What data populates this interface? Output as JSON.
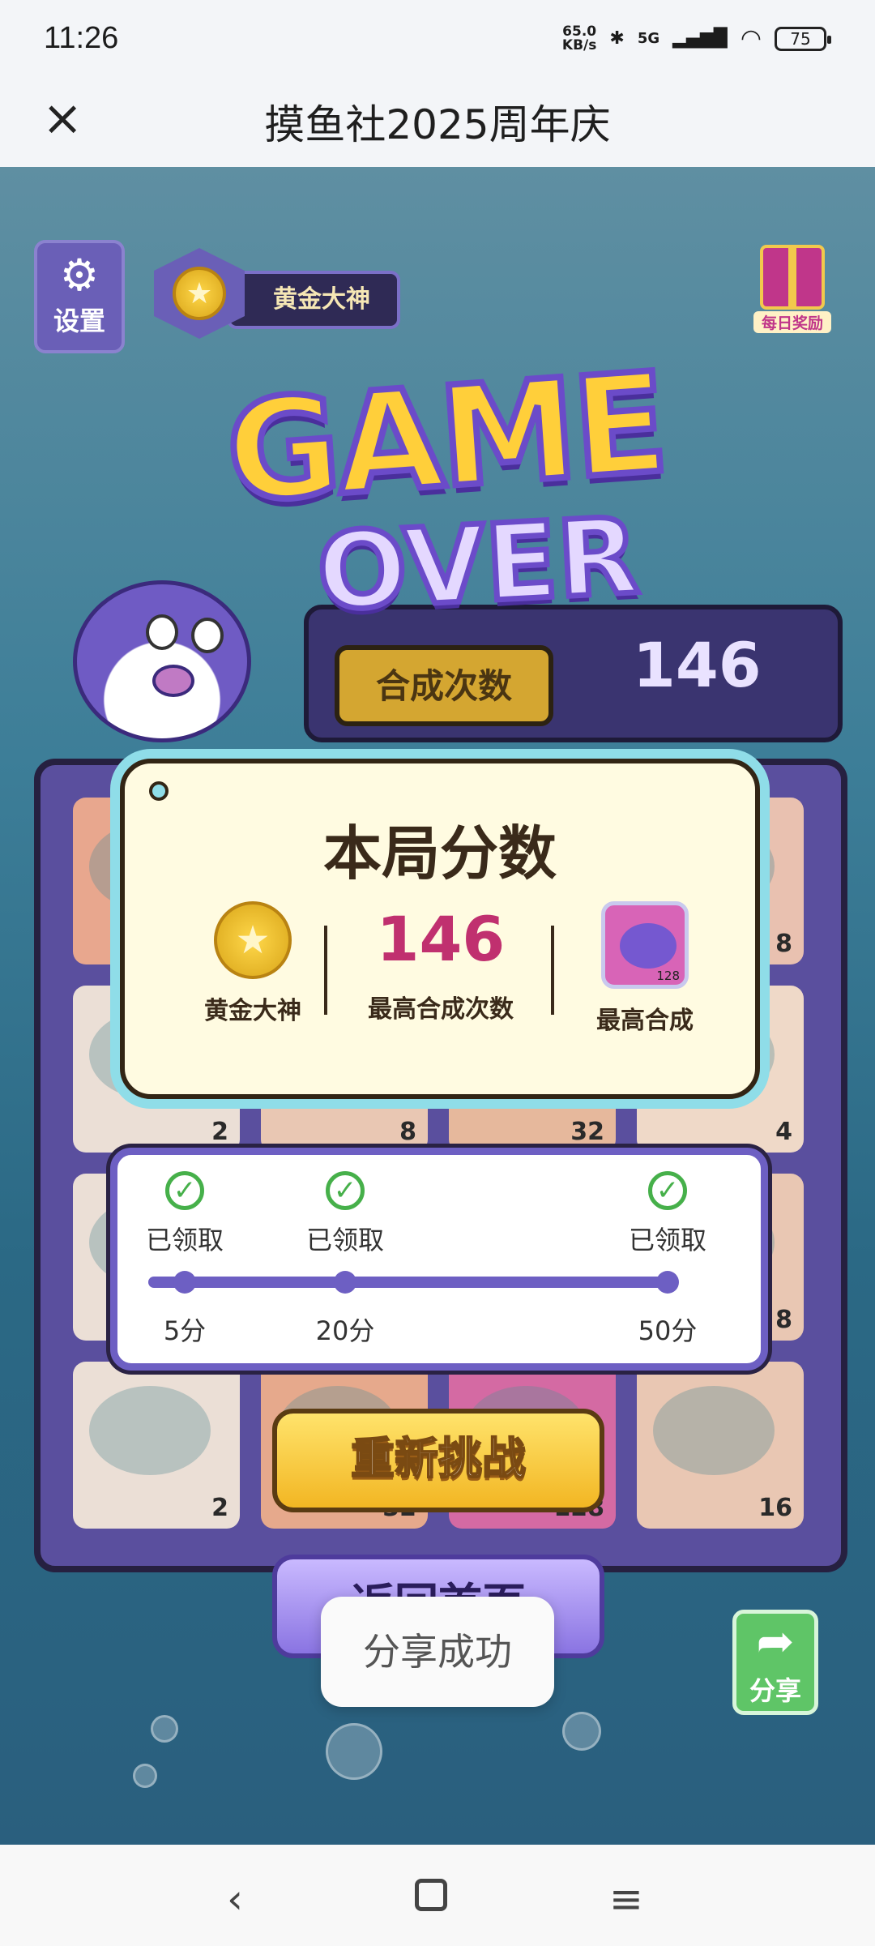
{
  "status_bar": {
    "time": "11:26",
    "net_speed_value": "65.0",
    "net_speed_unit": "KB/s",
    "network": "5G",
    "battery": "75"
  },
  "title_bar": {
    "close_symbol": "×",
    "title": "摸鱼社2025周年庆"
  },
  "hud": {
    "settings_label": "设置",
    "rank_title": "黄金大神",
    "daily_reward_label": "每日奖励"
  },
  "logo": {
    "line1": "GAME",
    "line2": "OVER"
  },
  "merge_counter": {
    "label": "合成次数",
    "value": "146"
  },
  "board": {
    "tiles": [
      {
        "value": "",
        "color": "#e8a78e"
      },
      {
        "value": "",
        "color": "#e8c3b0"
      },
      {
        "value": "",
        "color": "#e3c0b2"
      },
      {
        "value": "8",
        "color": "#e9c1b0"
      },
      {
        "value": "2",
        "color": "#ebdfd6"
      },
      {
        "value": "8",
        "color": "#e9c7b3"
      },
      {
        "value": "32",
        "color": "#e6b89c"
      },
      {
        "value": "4",
        "color": "#efd9c8"
      },
      {
        "value": "",
        "color": "#ebdfd6"
      },
      {
        "value": "",
        "color": "#e9c7b3"
      },
      {
        "value": "",
        "color": "#e6b89c"
      },
      {
        "value": "8",
        "color": "#e9c7b3"
      },
      {
        "value": "2",
        "color": "#ebdfd6"
      },
      {
        "value": "32",
        "color": "#e6a98c"
      },
      {
        "value": "128",
        "color": "#d46aa3"
      },
      {
        "value": "16",
        "color": "#e9c7b3"
      }
    ]
  },
  "score_card": {
    "heading": "本局分数",
    "rank_label": "黄金大神",
    "max_merges_value": "146",
    "max_merges_label": "最高合成次数",
    "max_merge_label": "最高合成",
    "max_merge_tile_value": "128"
  },
  "reward_progress": {
    "milestones": [
      {
        "points_label": "5分",
        "status": "已领取"
      },
      {
        "points_label": "20分",
        "status": "已领取"
      },
      {
        "points_label": "50分",
        "status": "已领取"
      }
    ]
  },
  "buttons": {
    "retry": "重新挑战",
    "home": "返回首页",
    "share": "分享"
  },
  "toast": "分享成功",
  "colors": {
    "purple": "#6d5fc3",
    "gold": "#f2c94c",
    "score_pink": "#c0306f",
    "share_green": "#5fc567"
  }
}
